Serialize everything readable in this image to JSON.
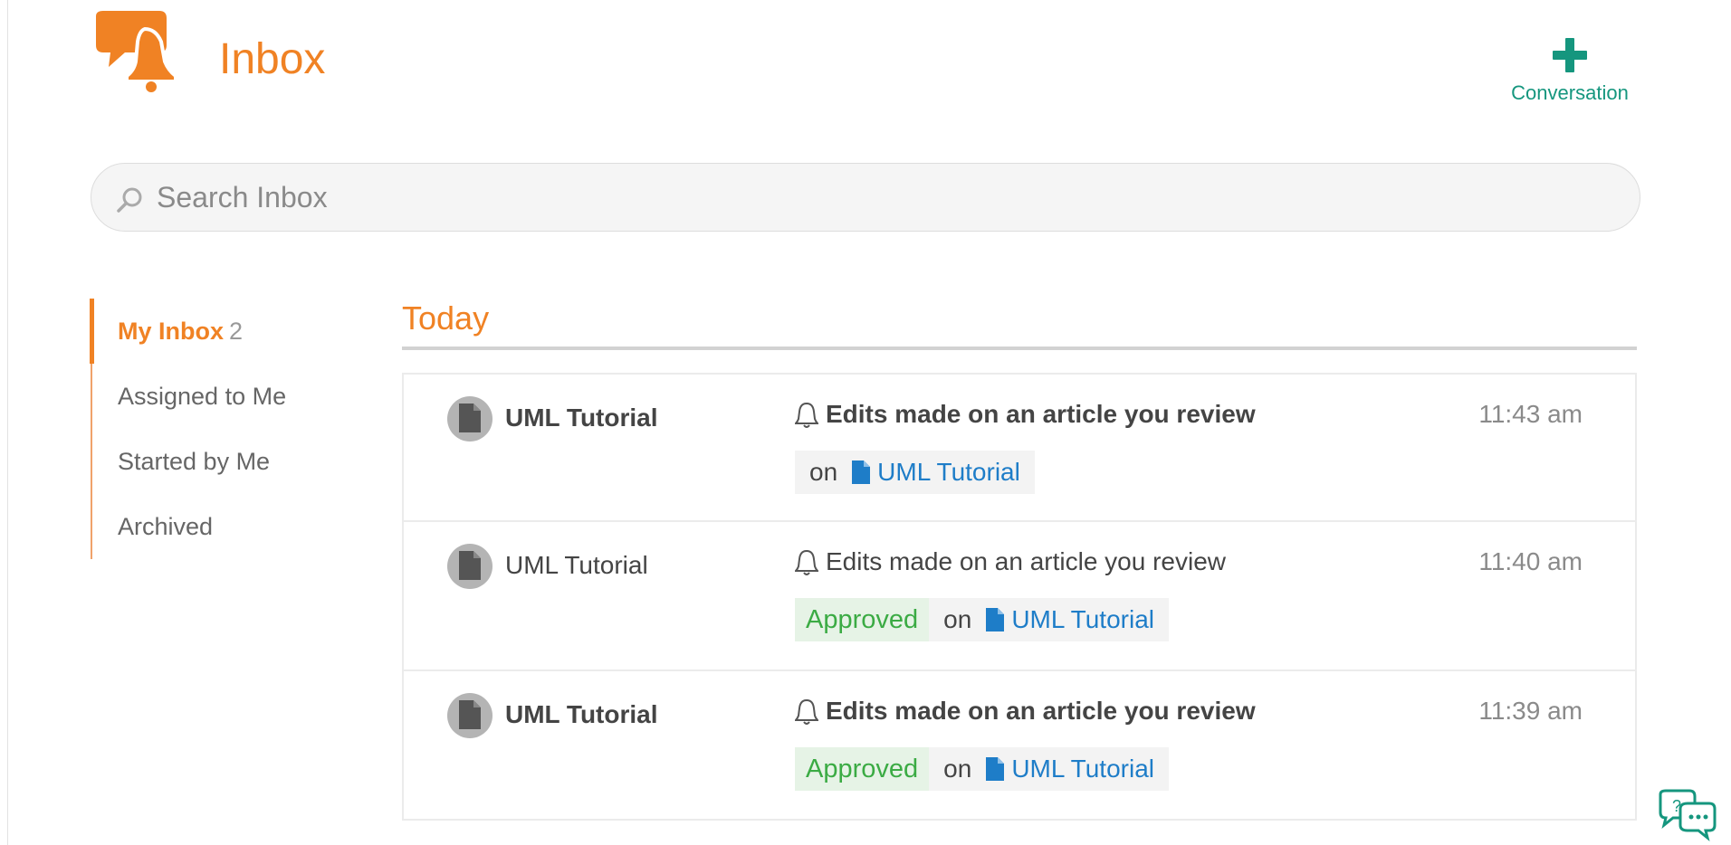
{
  "header": {
    "title": "Inbox",
    "new_conversation_label": "Conversation",
    "logo_icon": "inbox-bell-chat-logo"
  },
  "search": {
    "placeholder": "Search Inbox",
    "value": ""
  },
  "sidebar": {
    "items": [
      {
        "label": "My Inbox",
        "count": "2",
        "active": true
      },
      {
        "label": "Assigned to Me"
      },
      {
        "label": "Started by Me"
      },
      {
        "label": "Archived"
      }
    ]
  },
  "section": {
    "title": "Today"
  },
  "messages": [
    {
      "title": "UML Tutorial",
      "summary": "Edits made on an article you review",
      "time": "11:43 am",
      "unread": true,
      "status": "",
      "on_label": "on",
      "link": "UML Tutorial"
    },
    {
      "title": "UML Tutorial",
      "summary": "Edits made on an article you review",
      "time": "11:40 am",
      "unread": false,
      "status": "Approved",
      "on_label": "on",
      "link": "UML Tutorial"
    },
    {
      "title": "UML Tutorial",
      "summary": "Edits made on an article you review",
      "time": "11:39 am",
      "unread": true,
      "status": "Approved",
      "on_label": "on",
      "link": "UML Tutorial"
    }
  ],
  "colors": {
    "accent": "#f08224",
    "teal": "#15967e",
    "link": "#1e7dc8",
    "approved": "#3bab44"
  }
}
